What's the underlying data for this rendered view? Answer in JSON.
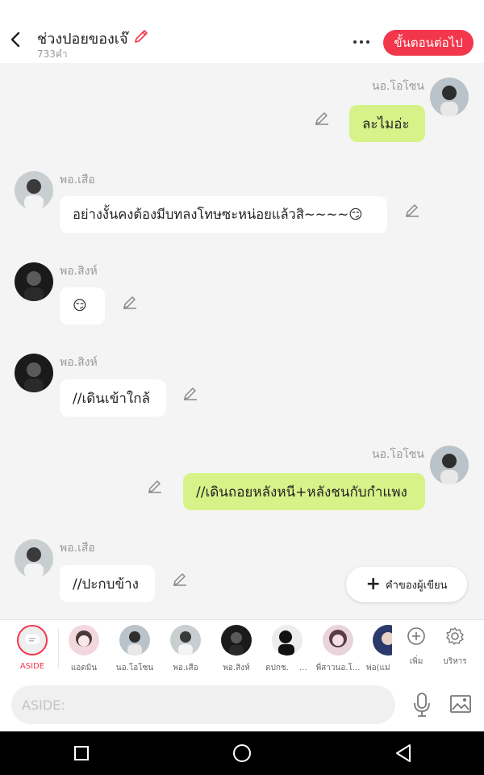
{
  "header": {
    "title": "ช่วงปอยของเจ๊",
    "count": "733คำ",
    "next_label": "ขั้นตอนต่อไป",
    "accent_color": "#f2364b"
  },
  "messages": [
    {
      "side": "right",
      "name": "นอ.โอโซน",
      "text": "ละไมอ่ะ"
    },
    {
      "side": "left",
      "name": "พอ.เสือ",
      "text": "อย่างงั้นคงต้องมีบทลงโทษซะหน่อยแล้วสิ~~~~😏"
    },
    {
      "side": "left",
      "name": "พอ.สิงห์",
      "text": "😏"
    },
    {
      "side": "left",
      "name": "พอ.สิงห์",
      "text": "//เดินเข้าใกล้"
    },
    {
      "side": "right",
      "name": "นอ.โอโซน",
      "text": "//เดินถอยหลังหนี+หลังชนกับกำแพง"
    },
    {
      "side": "left",
      "name": "พอ.เสือ",
      "text": "//ปะกบข้าง"
    }
  ],
  "fab": {
    "label": "คำของผู้เขียน"
  },
  "characters": [
    {
      "label": "ASIDE"
    },
    {
      "label": "แอดมิน"
    },
    {
      "label": "นอ.โอโซน"
    },
    {
      "label": "พอ.เสือ"
    },
    {
      "label": "พอ.สิงห์"
    },
    {
      "label": "ตปกช."
    },
    {
      "label": "..."
    },
    {
      "label": "พี่สาวนอ.โ..."
    },
    {
      "label": "พ่อ(แม่"
    }
  ],
  "tools": {
    "add_label": "เพิ่ม",
    "manage_label": "บริหาร"
  },
  "composer": {
    "placeholder": "ASIDE:"
  }
}
